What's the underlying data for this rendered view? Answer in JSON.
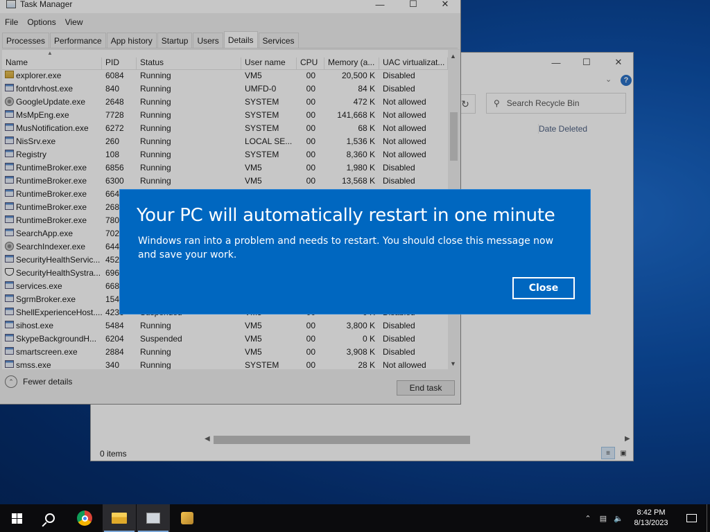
{
  "recycle_bin": {
    "search_placeholder": "Search Recycle Bin",
    "column_header": "Date Deleted",
    "status": "0 items"
  },
  "task_manager": {
    "title": "Task Manager",
    "menu": [
      "File",
      "Options",
      "View"
    ],
    "tabs": [
      "Processes",
      "Performance",
      "App history",
      "Startup",
      "Users",
      "Details",
      "Services"
    ],
    "active_tab": "Details",
    "columns": [
      "Name",
      "PID",
      "Status",
      "User name",
      "CPU",
      "Memory (a...",
      "UAC virtualizat..."
    ],
    "rows": [
      {
        "name": "explorer.exe",
        "pid": "6084",
        "status": "Running",
        "user": "VM5",
        "cpu": "00",
        "mem": "20,500 K",
        "uac": "Disabled",
        "icon": "folder-icon"
      },
      {
        "name": "fontdrvhost.exe",
        "pid": "840",
        "status": "Running",
        "user": "UMFD-0",
        "cpu": "00",
        "mem": "84 K",
        "uac": "Disabled",
        "icon": "app-icon"
      },
      {
        "name": "GoogleUpdate.exe",
        "pid": "2648",
        "status": "Running",
        "user": "SYSTEM",
        "cpu": "00",
        "mem": "472 K",
        "uac": "Not allowed",
        "icon": "gear-icon"
      },
      {
        "name": "MsMpEng.exe",
        "pid": "7728",
        "status": "Running",
        "user": "SYSTEM",
        "cpu": "00",
        "mem": "141,668 K",
        "uac": "Not allowed",
        "icon": "app-icon"
      },
      {
        "name": "MusNotification.exe",
        "pid": "6272",
        "status": "Running",
        "user": "SYSTEM",
        "cpu": "00",
        "mem": "68 K",
        "uac": "Not allowed",
        "icon": "app-icon"
      },
      {
        "name": "NisSrv.exe",
        "pid": "260",
        "status": "Running",
        "user": "LOCAL SE...",
        "cpu": "00",
        "mem": "1,536 K",
        "uac": "Not allowed",
        "icon": "app-icon"
      },
      {
        "name": "Registry",
        "pid": "108",
        "status": "Running",
        "user": "SYSTEM",
        "cpu": "00",
        "mem": "8,360 K",
        "uac": "Not allowed",
        "icon": "app-icon"
      },
      {
        "name": "RuntimeBroker.exe",
        "pid": "6856",
        "status": "Running",
        "user": "VM5",
        "cpu": "00",
        "mem": "1,980 K",
        "uac": "Disabled",
        "icon": "app-icon"
      },
      {
        "name": "RuntimeBroker.exe",
        "pid": "6300",
        "status": "Running",
        "user": "VM5",
        "cpu": "00",
        "mem": "13,568 K",
        "uac": "Disabled",
        "icon": "app-icon"
      },
      {
        "name": "RuntimeBroker.exe",
        "pid": "6640",
        "status": "",
        "user": "",
        "cpu": "",
        "mem": "",
        "uac": "",
        "icon": "app-icon"
      },
      {
        "name": "RuntimeBroker.exe",
        "pid": "2688",
        "status": "",
        "user": "",
        "cpu": "",
        "mem": "",
        "uac": "",
        "icon": "app-icon"
      },
      {
        "name": "RuntimeBroker.exe",
        "pid": "7808",
        "status": "",
        "user": "",
        "cpu": "",
        "mem": "",
        "uac": "",
        "icon": "app-icon"
      },
      {
        "name": "SearchApp.exe",
        "pid": "7020",
        "status": "",
        "user": "",
        "cpu": "",
        "mem": "",
        "uac": "",
        "icon": "app-icon"
      },
      {
        "name": "SearchIndexer.exe",
        "pid": "6448",
        "status": "",
        "user": "",
        "cpu": "",
        "mem": "",
        "uac": "",
        "icon": "gear-icon"
      },
      {
        "name": "SecurityHealthServic...",
        "pid": "4528",
        "status": "",
        "user": "",
        "cpu": "",
        "mem": "",
        "uac": "",
        "icon": "app-icon"
      },
      {
        "name": "SecurityHealthSystra...",
        "pid": "6968",
        "status": "",
        "user": "",
        "cpu": "",
        "mem": "",
        "uac": "",
        "icon": "shield-icon"
      },
      {
        "name": "services.exe",
        "pid": "668",
        "status": "",
        "user": "",
        "cpu": "",
        "mem": "",
        "uac": "",
        "icon": "app-icon"
      },
      {
        "name": "SgrmBroker.exe",
        "pid": "1544",
        "status": "",
        "user": "",
        "cpu": "",
        "mem": "",
        "uac": "",
        "icon": "app-icon"
      },
      {
        "name": "ShellExperienceHost....",
        "pid": "4236",
        "status": "Suspended",
        "user": "VM5",
        "cpu": "00",
        "mem": "0 K",
        "uac": "Disabled",
        "icon": "app-icon"
      },
      {
        "name": "sihost.exe",
        "pid": "5484",
        "status": "Running",
        "user": "VM5",
        "cpu": "00",
        "mem": "3,800 K",
        "uac": "Disabled",
        "icon": "app-icon"
      },
      {
        "name": "SkypeBackgroundH...",
        "pid": "6204",
        "status": "Suspended",
        "user": "VM5",
        "cpu": "00",
        "mem": "0 K",
        "uac": "Disabled",
        "icon": "app-icon"
      },
      {
        "name": "smartscreen.exe",
        "pid": "2884",
        "status": "Running",
        "user": "VM5",
        "cpu": "00",
        "mem": "3,908 K",
        "uac": "Disabled",
        "icon": "app-icon"
      },
      {
        "name": "smss.exe",
        "pid": "340",
        "status": "Running",
        "user": "SYSTEM",
        "cpu": "00",
        "mem": "28 K",
        "uac": "Not allowed",
        "icon": "app-icon"
      }
    ],
    "fewer_details": "Fewer details",
    "end_task": "End task"
  },
  "dialog": {
    "title": "Your PC will automatically restart in one minute",
    "message": "Windows ran into a problem and needs to restart. You should close this message now and save your work.",
    "close_label": "Close"
  },
  "taskbar": {
    "time": "8:42 PM",
    "date": "8/13/2023"
  }
}
